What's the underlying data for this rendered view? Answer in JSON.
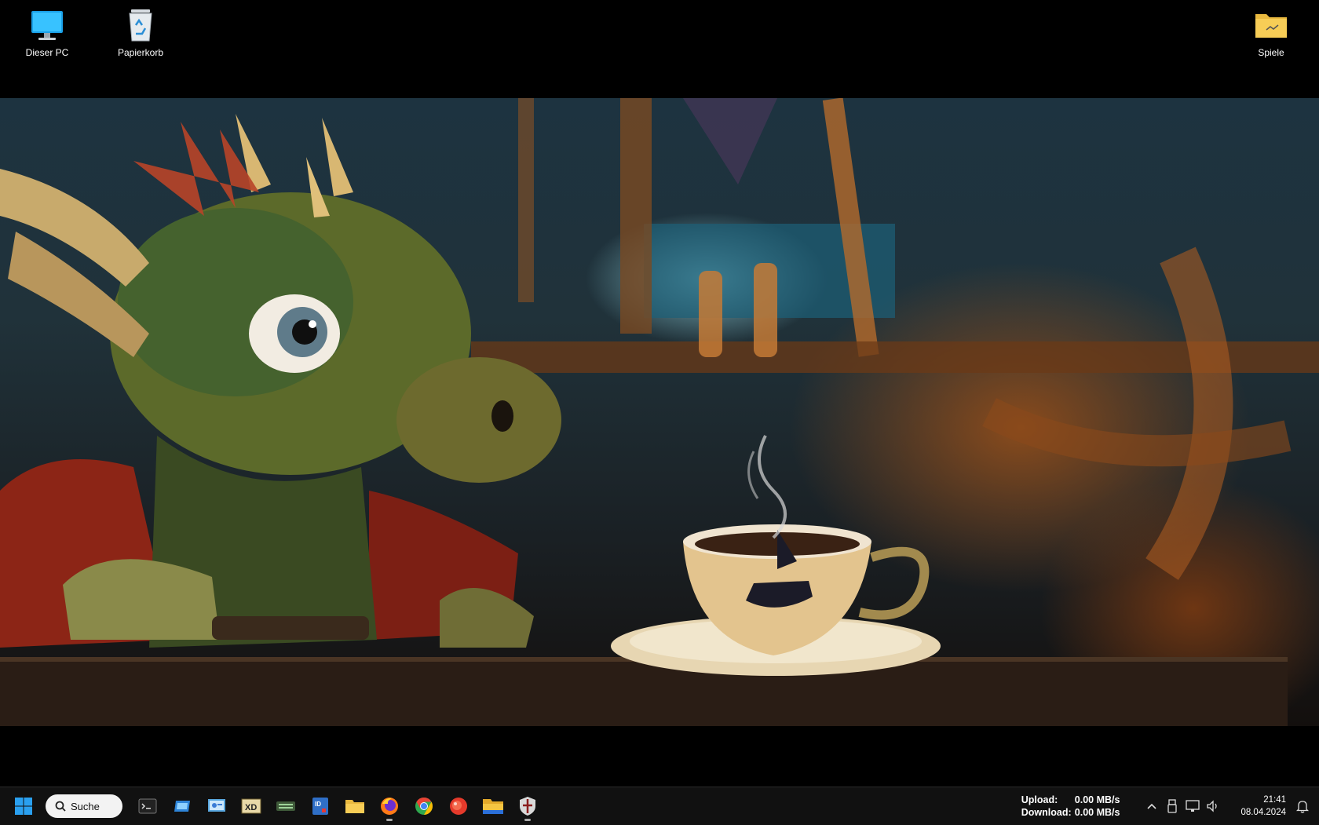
{
  "desktop": {
    "icons": [
      {
        "label": "Dieser PC",
        "icon": "computer-icon"
      },
      {
        "label": "Papierkorb",
        "icon": "recycle-bin-icon"
      },
      {
        "label": "Spiele",
        "icon": "folder-icon"
      }
    ]
  },
  "wallpaper": {
    "icon": "wallpaper-image"
  },
  "taskbar": {
    "search": {
      "label": "Suche",
      "icon": "search-icon"
    },
    "apps": [
      {
        "icon": "terminal-icon"
      },
      {
        "icon": "app-blue-window-icon"
      },
      {
        "icon": "control-panel-icon"
      },
      {
        "icon": "xd-app-icon"
      },
      {
        "icon": "keyboard-app-icon"
      },
      {
        "icon": "id-card-app-icon"
      },
      {
        "icon": "file-explorer-icon"
      },
      {
        "icon": "firefox-icon"
      },
      {
        "icon": "chrome-icon"
      },
      {
        "icon": "red-circle-app-icon"
      },
      {
        "icon": "folder-icon"
      },
      {
        "icon": "shield-app-icon"
      }
    ],
    "network": {
      "upload_label": "Upload:",
      "upload_value": "0.00 MB/s",
      "download_label": "Download:",
      "download_value": "0.00 MB/s"
    },
    "tray_icons": [
      "chevron-up-icon",
      "usb-icon",
      "network-icon",
      "volume-icon"
    ],
    "clock": {
      "time": "21:41",
      "date": "08.04.2024"
    },
    "notification_icon": "bell-icon",
    "colors": {
      "background": "#111111",
      "search_bg": "#f3f3f3"
    }
  }
}
